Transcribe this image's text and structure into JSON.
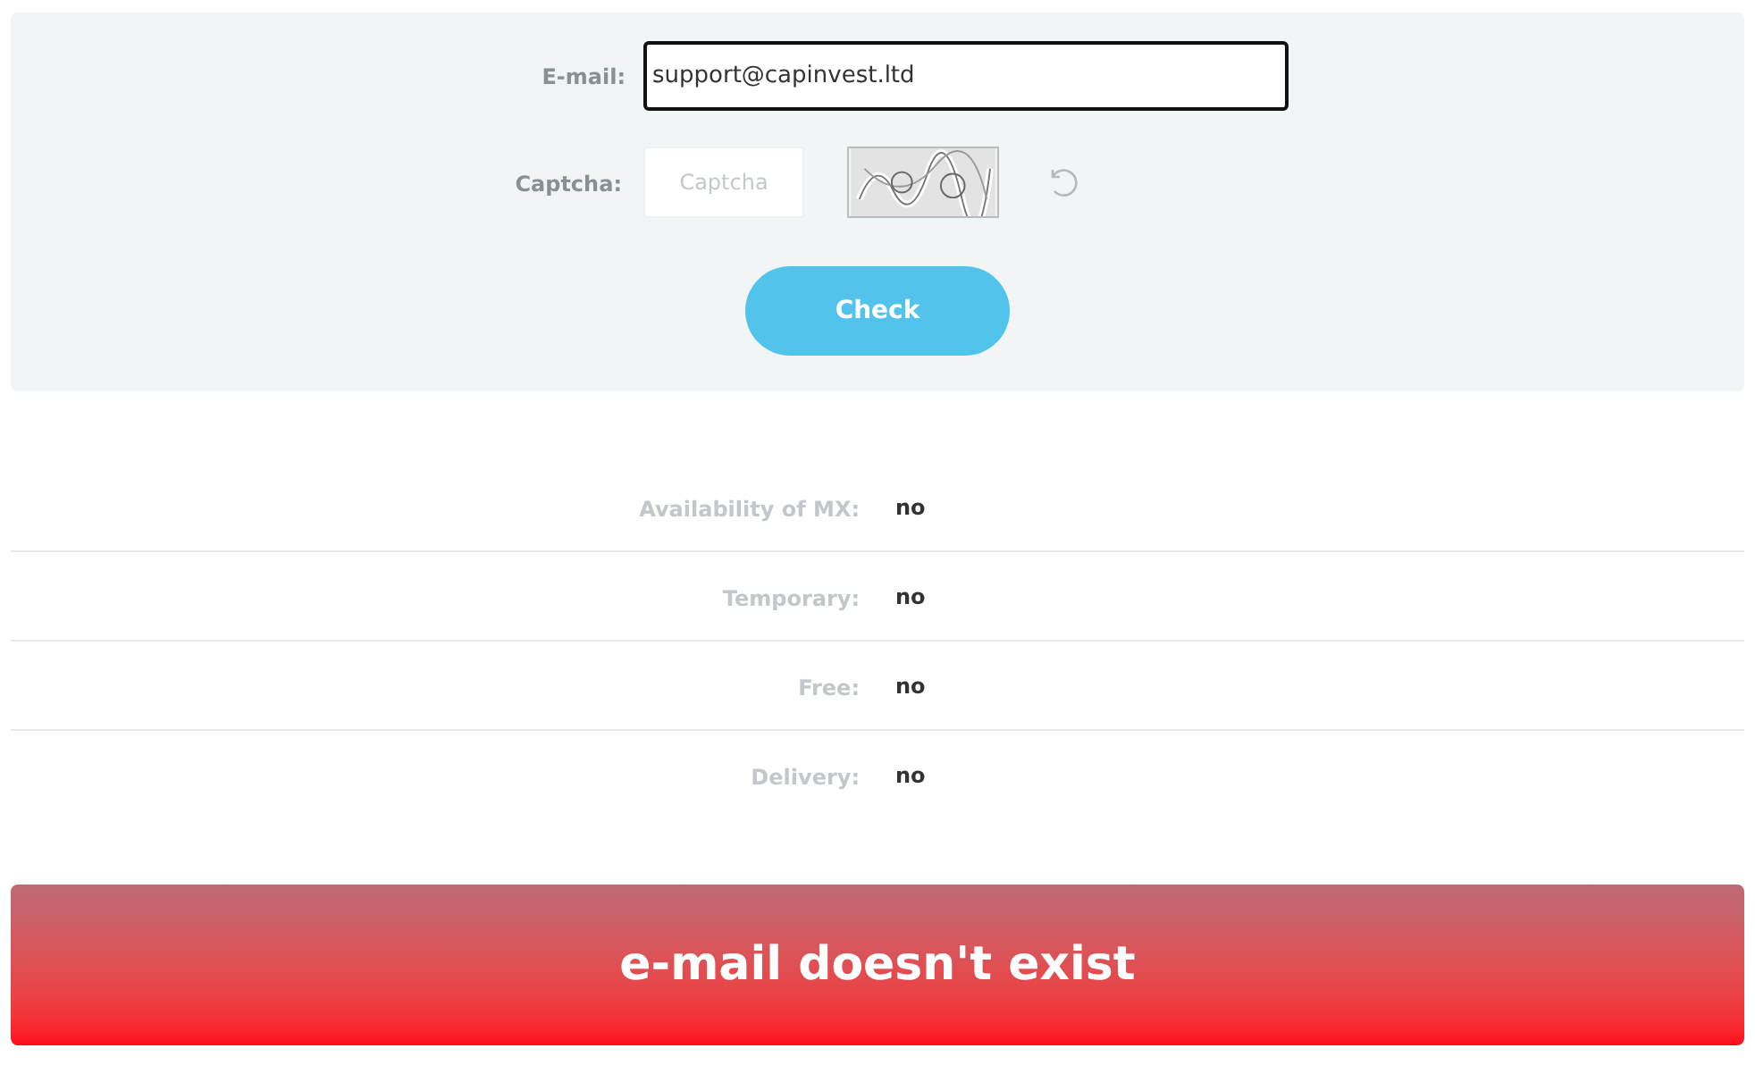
{
  "form": {
    "email_label": "E-mail:",
    "email_value": "support@capinvest.ltd",
    "captcha_label": "Captcha:",
    "captcha_placeholder": "Captcha",
    "check_button": "Check"
  },
  "results": [
    {
      "label": "Availability of MX:",
      "value": "no"
    },
    {
      "label": "Temporary:",
      "value": "no"
    },
    {
      "label": "Free:",
      "value": "no"
    },
    {
      "label": "Delivery:",
      "value": "no"
    }
  ],
  "verdict": "e-mail doesn't exist"
}
